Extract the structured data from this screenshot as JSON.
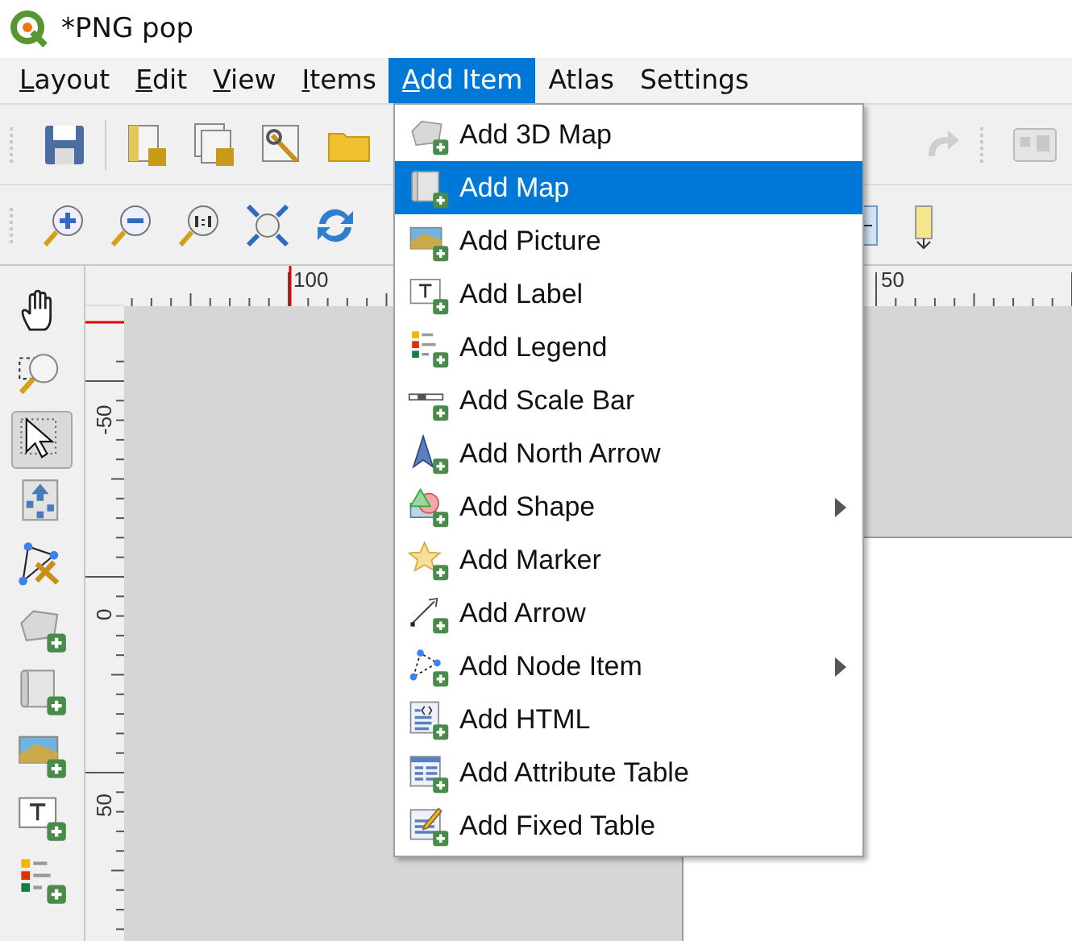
{
  "window": {
    "title": "*PNG pop"
  },
  "menubar": [
    {
      "label": "Layout",
      "mnemonic": true,
      "selected": false
    },
    {
      "label": "Edit",
      "mnemonic": true,
      "selected": false
    },
    {
      "label": "View",
      "mnemonic": true,
      "selected": false
    },
    {
      "label": "Items",
      "mnemonic": true,
      "selected": false
    },
    {
      "label": "Add Item",
      "mnemonic": true,
      "selected": true
    },
    {
      "label": "Atlas",
      "mnemonic": false,
      "selected": false
    },
    {
      "label": "Settings",
      "mnemonic": false,
      "selected": false
    }
  ],
  "tools": [
    {
      "kind": "pan",
      "selected": false
    },
    {
      "kind": "zoom",
      "selected": false
    },
    {
      "kind": "select",
      "selected": true
    },
    {
      "kind": "movecontent",
      "selected": false
    },
    {
      "kind": "editnodes",
      "selected": false
    },
    {
      "kind": "map3d",
      "selected": false
    },
    {
      "kind": "map",
      "selected": false
    },
    {
      "kind": "picture",
      "selected": false
    },
    {
      "kind": "label",
      "selected": false
    },
    {
      "kind": "legend",
      "selected": false
    }
  ],
  "rulers": {
    "horizontal": [
      "100",
      "50"
    ],
    "vertical": [
      "-50",
      "0",
      "50"
    ]
  },
  "menu": [
    {
      "kind": "map3d",
      "label": "Add 3D Map",
      "selected": false,
      "submenu": false
    },
    {
      "kind": "map",
      "label": "Add Map",
      "selected": true,
      "submenu": false
    },
    {
      "kind": "picture",
      "label": "Add Picture",
      "selected": false,
      "submenu": false
    },
    {
      "kind": "label",
      "label": "Add Label",
      "selected": false,
      "submenu": false
    },
    {
      "kind": "legend",
      "label": "Add Legend",
      "selected": false,
      "submenu": false
    },
    {
      "kind": "scalebar",
      "label": "Add Scale Bar",
      "selected": false,
      "submenu": false
    },
    {
      "kind": "northarrow",
      "label": "Add North Arrow",
      "selected": false,
      "submenu": false
    },
    {
      "kind": "shape",
      "label": "Add Shape",
      "selected": false,
      "submenu": true
    },
    {
      "kind": "marker",
      "label": "Add Marker",
      "selected": false,
      "submenu": false
    },
    {
      "kind": "arrow",
      "label": "Add Arrow",
      "selected": false,
      "submenu": false
    },
    {
      "kind": "node",
      "label": "Add Node Item",
      "selected": false,
      "submenu": true
    },
    {
      "kind": "html",
      "label": "Add HTML",
      "selected": false,
      "submenu": false
    },
    {
      "kind": "attributetable",
      "label": "Add Attribute Table",
      "selected": false,
      "submenu": false
    },
    {
      "kind": "fixedtable",
      "label": "Add Fixed Table",
      "selected": false,
      "submenu": false
    }
  ]
}
